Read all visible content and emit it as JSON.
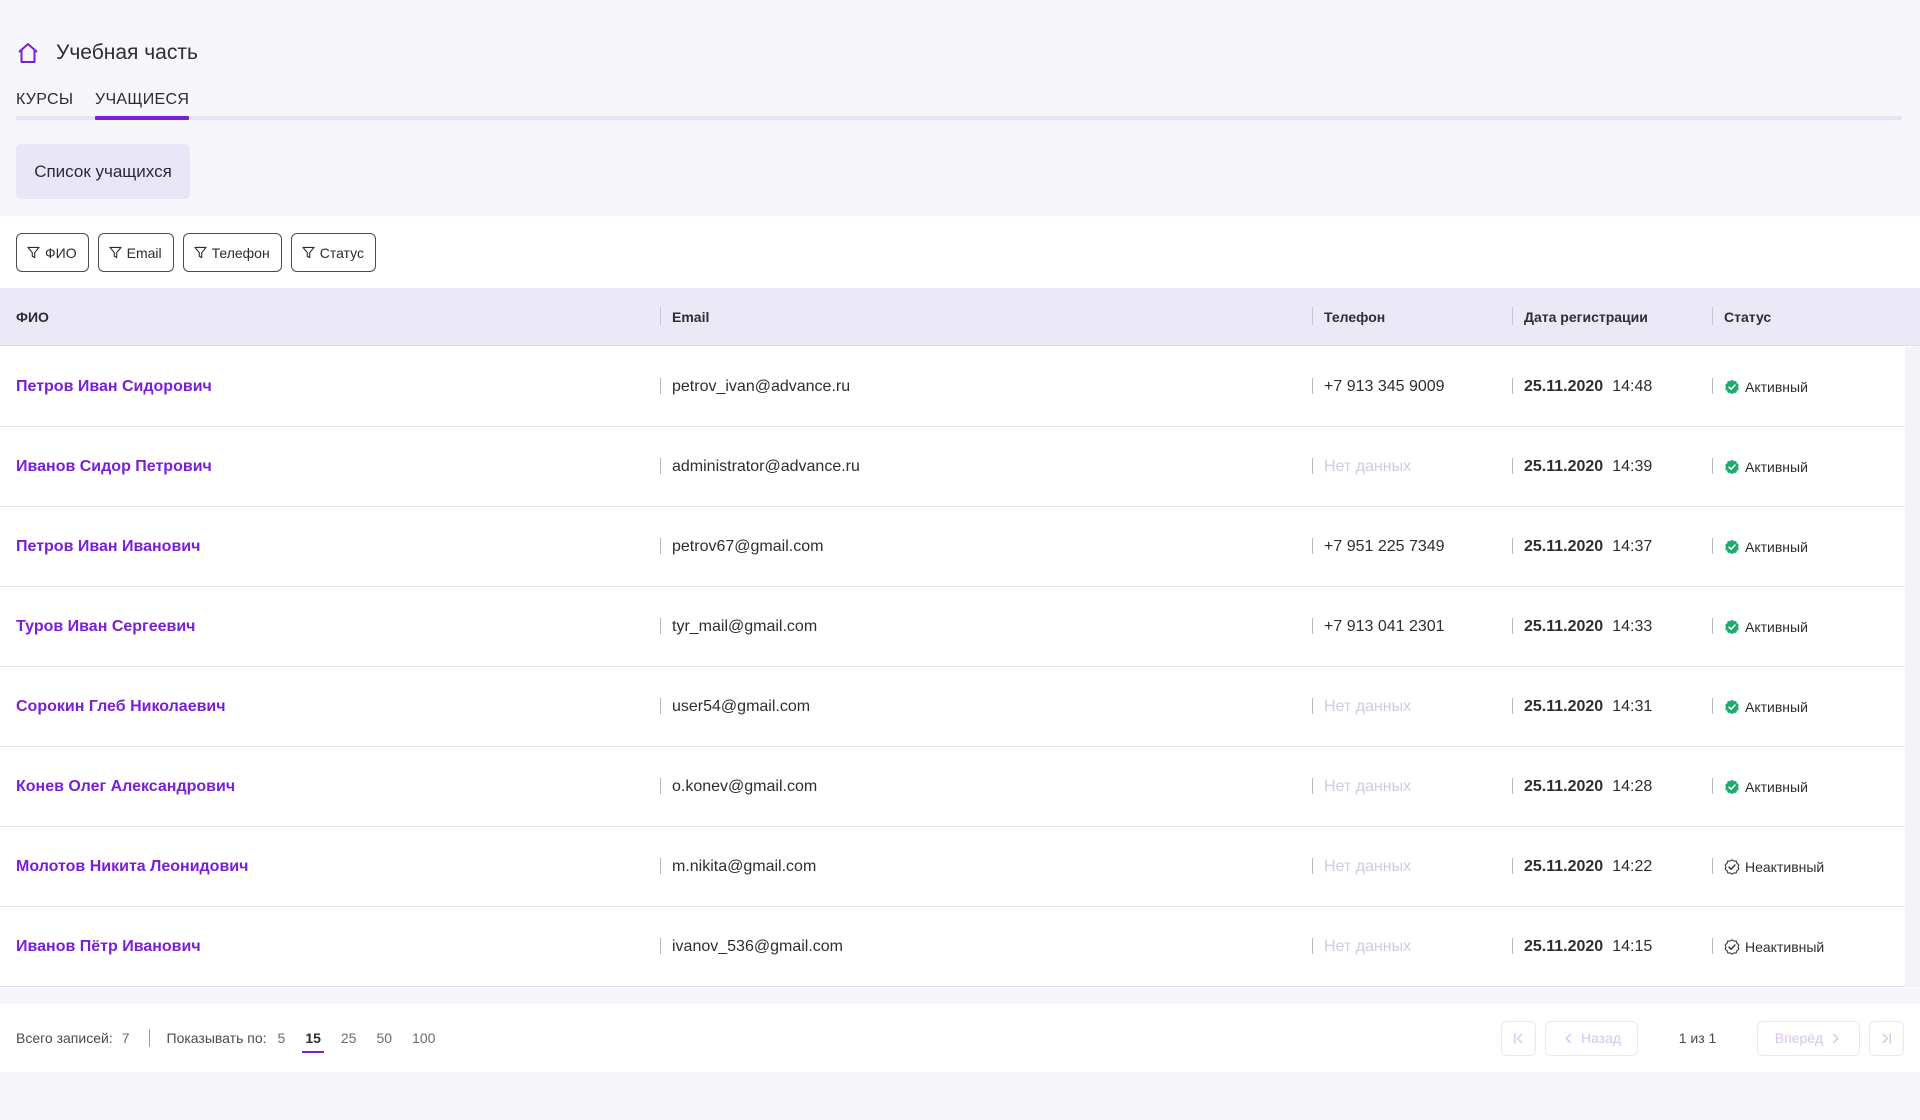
{
  "header": {
    "title": "Учебная часть",
    "icon": "home-icon"
  },
  "tabs": [
    {
      "label": "КУРСЫ",
      "active": false
    },
    {
      "label": "УЧАЩИЕСЯ",
      "active": true
    }
  ],
  "section_label": "Список учащихся",
  "filters": [
    "ФИО",
    "Email",
    "Телефон",
    "Статус"
  ],
  "columns": {
    "name": "ФИО",
    "email": "Email",
    "phone": "Телефон",
    "date": "Дата регистрации",
    "status": "Статус"
  },
  "rows": [
    {
      "name": "Петров Иван Сидорович",
      "email": "petrov_ivan@advance.ru",
      "phone": "+7 913 345 9009",
      "date": "25.11.2020",
      "time": "14:48",
      "status": "Активный",
      "active": true
    },
    {
      "name": "Иванов Сидор Петрович",
      "email": "administrator@advance.ru",
      "phone": "Нет данных",
      "date": "25.11.2020",
      "time": "14:39",
      "status": "Активный",
      "active": true
    },
    {
      "name": "Петров Иван Иванович",
      "email": "petrov67@gmail.com",
      "phone": "+7 951 225 7349",
      "date": "25.11.2020",
      "time": "14:37",
      "status": "Активный",
      "active": true
    },
    {
      "name": "Туров Иван Сергеевич",
      "email": "tyr_mail@gmail.com",
      "phone": "+7 913 041 2301",
      "date": "25.11.2020",
      "time": "14:33",
      "status": "Активный",
      "active": true
    },
    {
      "name": "Сорокин Глеб Николаевич",
      "email": "user54@gmail.com",
      "phone": "Нет данных",
      "date": "25.11.2020",
      "time": "14:31",
      "status": "Активный",
      "active": true
    },
    {
      "name": "Конев Олег Александрович",
      "email": "o.konev@gmail.com",
      "phone": "Нет данных",
      "date": "25.11.2020",
      "time": "14:28",
      "status": "Активный",
      "active": true
    },
    {
      "name": "Молотов Никита Леонидович",
      "email": "m.nikita@gmail.com",
      "phone": "Нет данных",
      "date": "25.11.2020",
      "time": "14:22",
      "status": "Неактивный",
      "active": false
    },
    {
      "name": "Иванов Пётр Иванович",
      "email": "ivanov_536@gmail.com",
      "phone": "Нет данных",
      "date": "25.11.2020",
      "time": "14:15",
      "status": "Неактивный",
      "active": false
    }
  ],
  "footer": {
    "total_label": "Всего записей:",
    "total": "7",
    "per_page_label": "Показывать по:",
    "page_sizes": [
      "5",
      "15",
      "25",
      "50",
      "100"
    ],
    "page_size_selected": "15",
    "prev": "Назад",
    "next": "Вперёд",
    "page_info": "1 из 1"
  },
  "colors": {
    "accent": "#7b1fd6",
    "active_status": "#1faa6e",
    "header_bg": "#ebe8f7",
    "page_bg": "#f7f6fb"
  }
}
